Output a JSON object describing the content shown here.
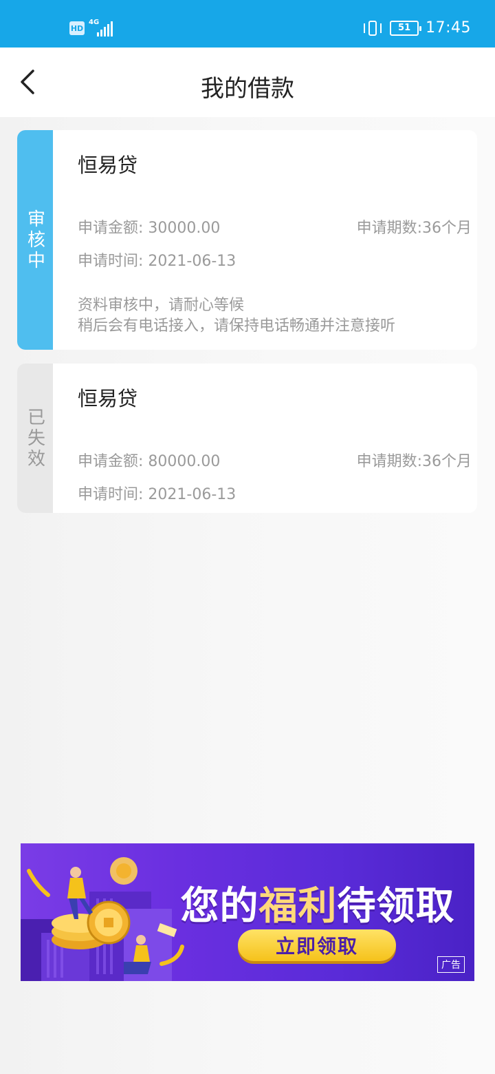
{
  "status_bar": {
    "hd": "HD",
    "network": "4G",
    "battery": "51",
    "time": "17:45"
  },
  "header": {
    "title": "我的借款",
    "back_icon": "chevron-left-icon"
  },
  "loans": [
    {
      "status": "审核中",
      "status_color": "#4fbeef",
      "product": "恒易贷",
      "amount_label": "申请金额: 30000.00",
      "term_label": "申请期数:36个月",
      "time_label": "申请时间: 2021-06-13",
      "note_line1": "资料审核中，请耐心等候",
      "note_line2": "稍后会有电话接入，请保持电话畅通并注意接听"
    },
    {
      "status": "已失效",
      "status_color": "#e8e8e8",
      "product": "恒易贷",
      "amount_label": "申请金额: 80000.00",
      "term_label": "申请期数:36个月",
      "time_label": "申请时间: 2021-06-13"
    }
  ],
  "ad": {
    "headline_prefix": "您的",
    "headline_highlight": "福利",
    "headline_suffix": "待领取",
    "cta": "立即领取",
    "label": "广告"
  },
  "colors": {
    "status_bar": "#17a7e8",
    "accent": "#4fbeef",
    "ad_cta": "#f5c21b"
  }
}
